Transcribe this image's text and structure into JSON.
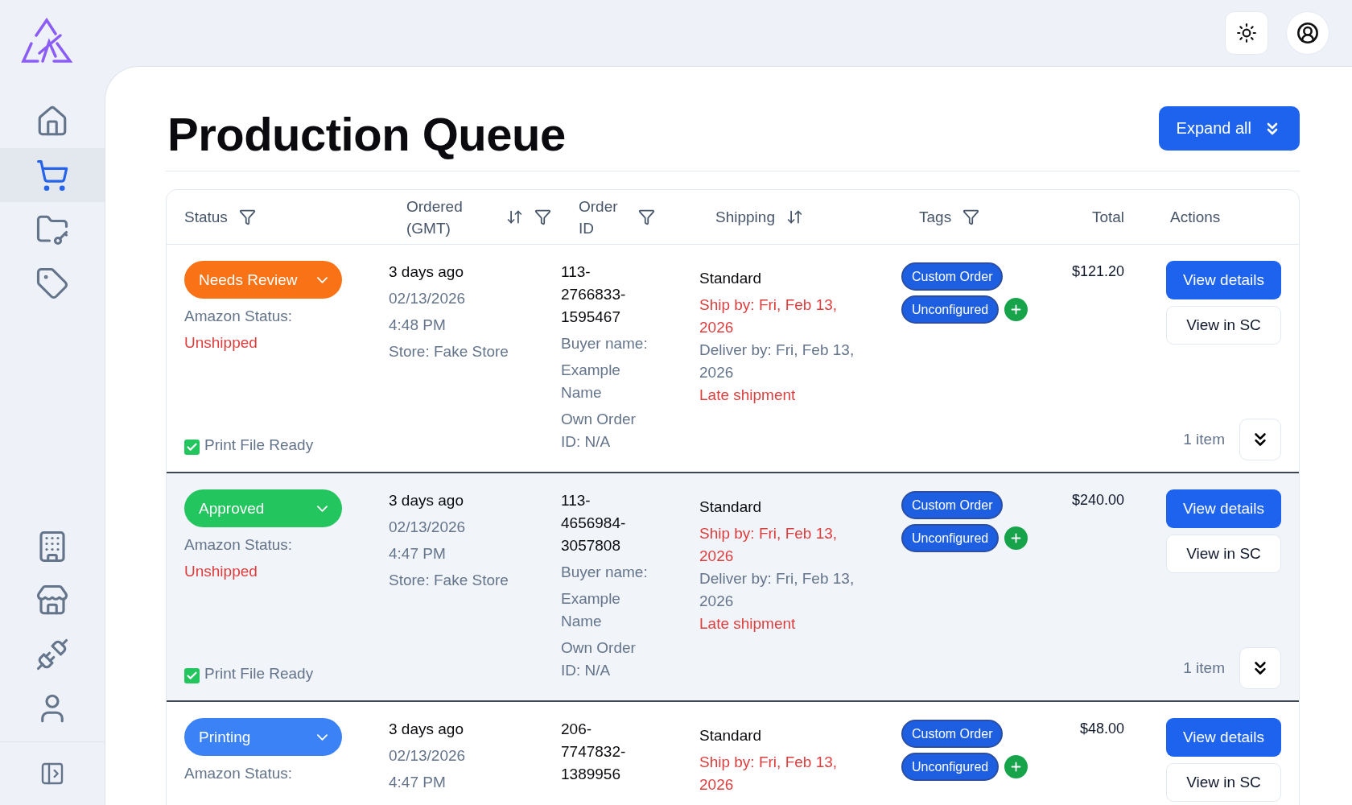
{
  "sidebar": {
    "top_items": [
      {
        "kind": "home",
        "selected": false
      },
      {
        "kind": "cart",
        "selected": true
      },
      {
        "kind": "folder",
        "selected": false
      },
      {
        "kind": "tag",
        "selected": false
      }
    ],
    "bottom_items": [
      {
        "kind": "building",
        "selected": false
      },
      {
        "kind": "store",
        "selected": false
      },
      {
        "kind": "plug",
        "selected": false
      },
      {
        "kind": "user",
        "selected": false
      }
    ]
  },
  "page": {
    "title": "Production Queue",
    "expand_button": "Expand all"
  },
  "table": {
    "columns": [
      {
        "label": "Status",
        "sortable": false,
        "filterable": true
      },
      {
        "label": "Ordered (GMT)",
        "sortable": true,
        "filterable": true
      },
      {
        "label": "Order ID",
        "sortable": false,
        "filterable": true
      },
      {
        "label": "Shipping",
        "sortable": true,
        "filterable": false
      },
      {
        "label": "Tags",
        "sortable": false,
        "filterable": true
      },
      {
        "label": "Total",
        "sortable": false,
        "filterable": false
      },
      {
        "label": "Actions",
        "sortable": false,
        "filterable": false
      }
    ],
    "rows": [
      {
        "highlighted": false,
        "status": {
          "label": "Needs Review",
          "color": "#f97316"
        },
        "amazon_status_label": "Amazon Status:",
        "amazon_status": "Unshipped",
        "print_file": {
          "label": "Print File Ready",
          "checked": true
        },
        "ordered": [
          "3 days ago",
          "02/13/2026",
          "4:48 PM",
          "Store: Fake Store"
        ],
        "order_id": "113-2766833-1595467",
        "order_details": [
          "Buyer name:",
          "Example Name",
          "Own Order ID: N/A"
        ],
        "shipping": [
          {
            "kind": "method",
            "text": "Standard"
          },
          {
            "kind": "ship_by",
            "text": "Ship by: Fri, Feb 13, 2026"
          },
          {
            "kind": "deliver_by",
            "text": "Deliver by: Fri, Feb 13, 2026"
          },
          {
            "kind": "warning",
            "text": "Late shipment"
          }
        ],
        "tags": [
          "Custom Order",
          "Unconfigured"
        ],
        "total": "$121.20",
        "actions": [
          "View details",
          "View in SC"
        ],
        "items": "1 item"
      },
      {
        "highlighted": true,
        "status": {
          "label": "Approved",
          "color": "#22c55e"
        },
        "amazon_status_label": "Amazon Status:",
        "amazon_status": "Unshipped",
        "print_file": {
          "label": "Print File Ready",
          "checked": true
        },
        "ordered": [
          "3 days ago",
          "02/13/2026",
          "4:47 PM",
          "Store: Fake Store"
        ],
        "order_id": "113-4656984-3057808",
        "order_details": [
          "Buyer name:",
          "Example Name",
          "Own Order ID: N/A"
        ],
        "shipping": [
          {
            "kind": "method",
            "text": "Standard"
          },
          {
            "kind": "ship_by",
            "text": "Ship by: Fri, Feb 13, 2026"
          },
          {
            "kind": "deliver_by",
            "text": "Deliver by: Fri, Feb 13, 2026"
          },
          {
            "kind": "warning",
            "text": "Late shipment"
          }
        ],
        "tags": [
          "Custom Order",
          "Unconfigured"
        ],
        "total": "$240.00",
        "actions": [
          "View details",
          "View in SC"
        ],
        "items": "1 item"
      },
      {
        "highlighted": false,
        "status": {
          "label": "Printing",
          "color": "#3b82f6"
        },
        "amazon_status_label": "Amazon Status:",
        "ordered": [
          "3 days ago",
          "02/13/2026",
          "4:47 PM"
        ],
        "order_id": "206-7747832-1389956",
        "shipping": [
          {
            "kind": "method",
            "text": "Standard"
          },
          {
            "kind": "ship_by",
            "text": "Ship by: Fri, Feb 13, 2026"
          }
        ],
        "tags": [
          "Custom Order",
          "Unconfigured"
        ],
        "total": "$48.00",
        "actions": [
          "View details",
          "View in SC"
        ]
      }
    ]
  }
}
